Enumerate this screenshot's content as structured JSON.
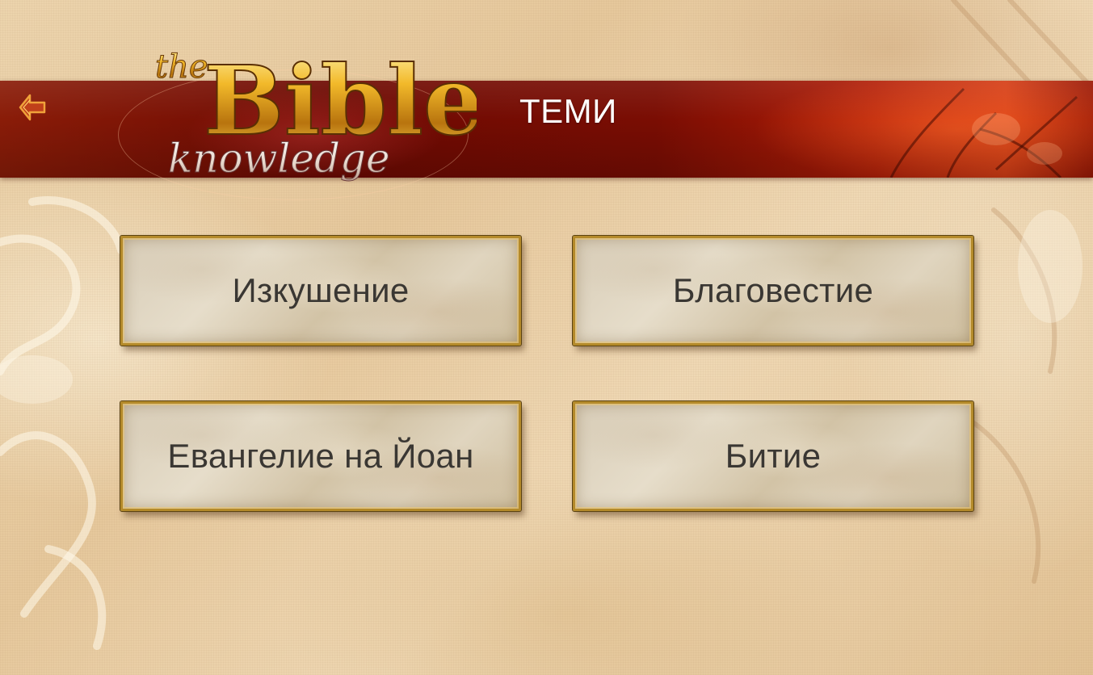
{
  "header": {
    "title": "ТЕМИ",
    "back_icon": "back-arrow-icon",
    "logo": {
      "word_the": "the",
      "word_bible": "Bible",
      "word_knowledge": "knowledge"
    }
  },
  "topics": [
    {
      "label": "Изкушение"
    },
    {
      "label": "Благовестие"
    },
    {
      "label": "Евангелие на Йоан"
    },
    {
      "label": "Битие"
    }
  ],
  "colors": {
    "header_red": "#7a0d03",
    "accent_gold": "#d9a520",
    "button_border": "#b48a2a",
    "button_text": "#3a3733",
    "title_text": "#ffffff"
  }
}
